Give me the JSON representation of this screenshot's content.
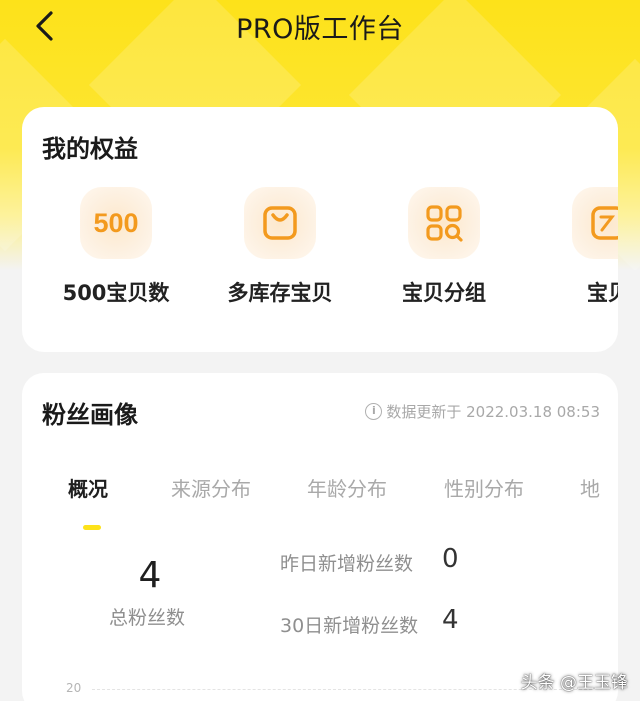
{
  "nav": {
    "title": "PRO版工作台",
    "back_icon": "chevron-left-icon"
  },
  "benefits_card": {
    "title": "我的权益",
    "items": [
      {
        "icon": "count-500-icon",
        "icon_text": "500",
        "label": "500宝贝数"
      },
      {
        "icon": "shopping-bag-icon",
        "label": "多库存宝贝"
      },
      {
        "icon": "grid-search-icon",
        "label": "宝贝分组"
      },
      {
        "icon": "partial-icon",
        "label": "宝贝"
      }
    ]
  },
  "fans_card": {
    "title": "粉丝画像",
    "update_text": "数据更新于 2022.03.18 08:53",
    "info_icon_text": "i",
    "tabs": [
      {
        "label": "概况",
        "active": true
      },
      {
        "label": "来源分布",
        "active": false
      },
      {
        "label": "年龄分布",
        "active": false
      },
      {
        "label": "性别分布",
        "active": false
      },
      {
        "label": "地",
        "active": false
      }
    ],
    "total_fans": {
      "value": "4",
      "label": "总粉丝数"
    },
    "stats": [
      {
        "label": "昨日新增粉丝数",
        "value": "0"
      },
      {
        "label": "30日新增粉丝数",
        "value": "4"
      }
    ],
    "axis_tick": "20"
  },
  "watermark": "头条 @王玉锋",
  "colors": {
    "brand_yellow": "#fde21a",
    "icon_orange": "#f39a1e",
    "background": "#f3f3f3"
  }
}
